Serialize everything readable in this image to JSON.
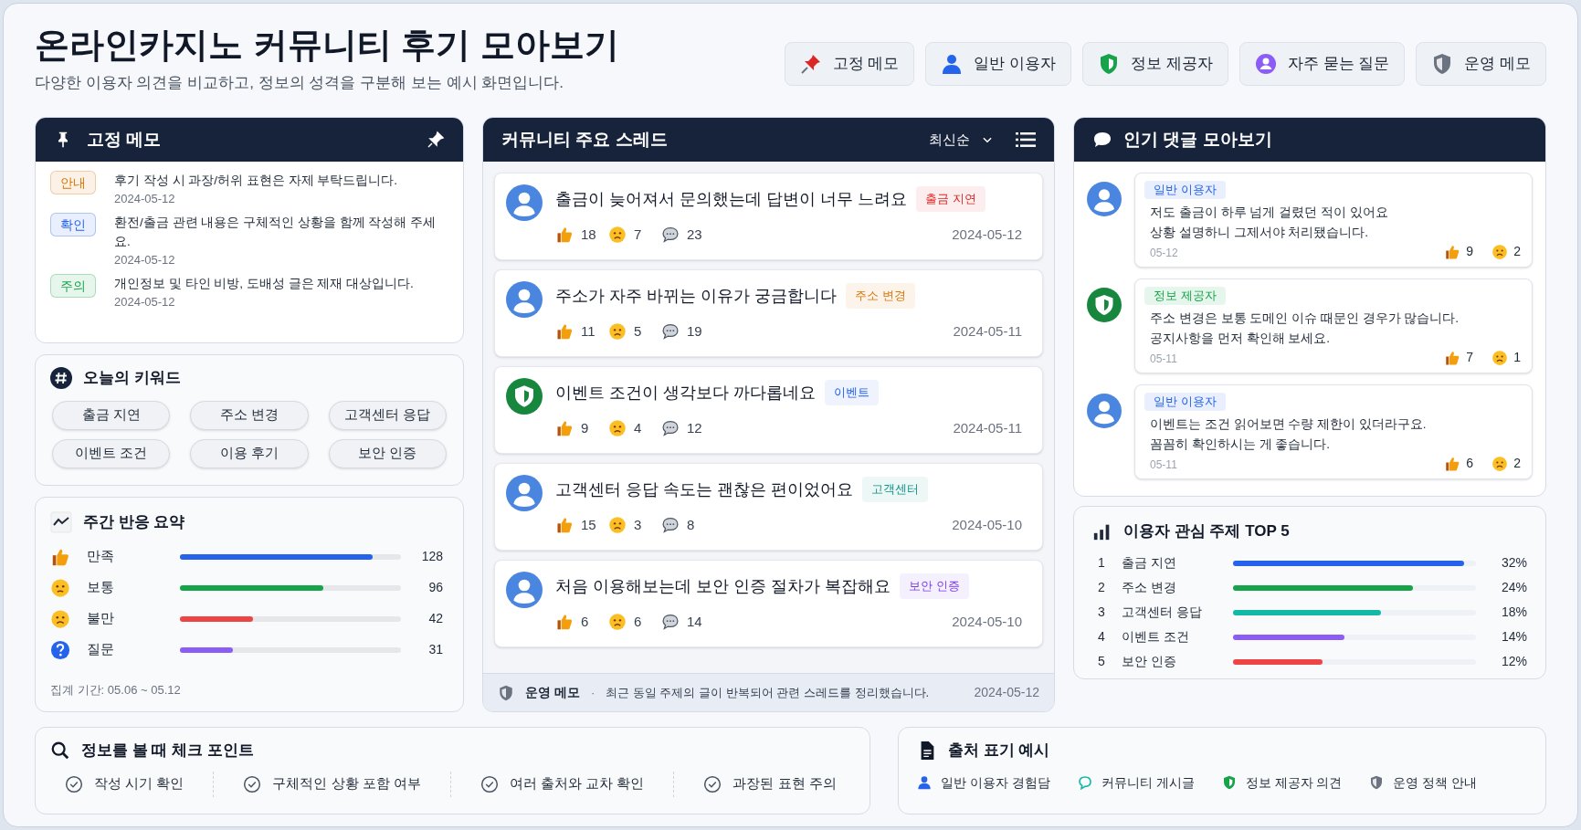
{
  "header": {
    "title": "온라인카지노 커뮤니티 후기 모아보기",
    "subtitle": "다양한 이용자 의견을 비교하고, 정보의 성격을 구분해 보는 예시 화면입니다."
  },
  "legend": [
    {
      "kind": "pin",
      "label": "고정 메모"
    },
    {
      "kind": "user",
      "label": "일반 이용자"
    },
    {
      "kind": "provider",
      "label": "정보 제공자"
    },
    {
      "kind": "faq",
      "label": "자주 묻는 질문"
    },
    {
      "kind": "admin",
      "label": "운영 메모"
    }
  ],
  "pinned": {
    "title": "고정 메모",
    "items": [
      {
        "badge": "안내",
        "color": "#d97706",
        "text": "후기 작성 시 과장/허위 표현은 자제 부탁드립니다.",
        "date": "2024-05-12"
      },
      {
        "badge": "확인",
        "color": "#2563eb",
        "text": "환전/출금 관련 내용은 구체적인 상황을 함께 작성해 주세요.",
        "date": "2024-05-12"
      },
      {
        "badge": "주의",
        "color": "#16a34a",
        "text": "개인정보 및 타인 비방, 도배성 글은 제재 대상입니다.",
        "date": "2024-05-12"
      }
    ]
  },
  "keywords": {
    "title": "오늘의 키워드",
    "items": [
      "출금 지연",
      "주소 변경",
      "고객센터 응답",
      "이벤트 조건",
      "이용 후기",
      "보안 인증"
    ]
  },
  "weekly": {
    "title": "주간 반응 요약",
    "rows": [
      {
        "kind": "like",
        "label": "만족",
        "level": 0.87,
        "value": "128",
        "color": "#2563eb"
      },
      {
        "kind": "neutral",
        "label": "보통",
        "level": 0.65,
        "value": "96",
        "color": "#16a34a"
      },
      {
        "kind": "sad",
        "label": "불만",
        "level": 0.33,
        "value": "42",
        "color": "#ef4444"
      },
      {
        "kind": "question",
        "label": "질문",
        "level": 0.24,
        "value": "31",
        "color": "#8b5cf6"
      }
    ],
    "footnote": "집계 기간: 05.06 ~ 05.12"
  },
  "threads": {
    "title": "커뮤니티 주요 스레드",
    "sort": "최신순",
    "items": [
      {
        "kind": "user",
        "title": "출금이 늦어져서 문의했는데 답변이 너무 느려요",
        "tag": "출금 지연",
        "color": "#dc2626",
        "likes": "18",
        "dislikes": "7",
        "comments": "23",
        "date": "2024-05-12"
      },
      {
        "kind": "user",
        "title": "주소가 자주 바뀌는 이유가 궁금합니다",
        "tag": "주소 변경",
        "color": "#d97706",
        "likes": "11",
        "dislikes": "5",
        "comments": "19",
        "date": "2024-05-11"
      },
      {
        "kind": "provider",
        "title": "이벤트 조건이 생각보다 까다롭네요",
        "tag": "이벤트",
        "color": "#2563eb",
        "likes": "9",
        "dislikes": "4",
        "comments": "12",
        "date": "2024-05-11"
      },
      {
        "kind": "user",
        "title": "고객센터 응답 속도는 괜찮은 편이었어요",
        "tag": "고객센터",
        "color": "#0d9488",
        "likes": "15",
        "dislikes": "3",
        "comments": "8",
        "date": "2024-05-10"
      },
      {
        "kind": "user",
        "title": "처음 이용해보는데 보안 인증 절차가 복잡해요",
        "tag": "보안 인증",
        "color": "#7c3aed",
        "likes": "6",
        "dislikes": "6",
        "comments": "14",
        "date": "2024-05-10"
      }
    ],
    "notice": {
      "label": "운영 메모",
      "separator": "·",
      "text": "최근 동일 주제의 글이 반복되어 관련 스레드를 정리했습니다.",
      "date": "2024-05-12"
    }
  },
  "comments": {
    "title": "인기 댓글 모아보기",
    "items": [
      {
        "kind": "user",
        "role": "일반 이용자",
        "text": "저도 출금이 하루 넘게 걸렸던 적이 있어요\n상황 설명하니 그제서야 처리됐습니다.",
        "date": "05-12",
        "likes": "9",
        "dislikes": "2"
      },
      {
        "kind": "provider",
        "role": "정보 제공자",
        "text": "주소 변경은 보통 도메인 이슈 때문인 경우가 많습니다.\n공지사항을 먼저 확인해 보세요.",
        "date": "05-11",
        "likes": "7",
        "dislikes": "1"
      },
      {
        "kind": "user",
        "role": "일반 이용자",
        "text": "이벤트는 조건 읽어보면 수량 제한이 있더라구요.\n꼼꼼히 확인하시는 게 좋습니다.",
        "date": "05-11",
        "likes": "6",
        "dislikes": "2"
      }
    ]
  },
  "top5": {
    "title": "이용자 관심 주제 TOP 5",
    "rows": [
      {
        "rank": "1",
        "label": "출금 지연",
        "level": 0.95,
        "value": "32%",
        "color": "#2563eb"
      },
      {
        "rank": "2",
        "label": "주소 변경",
        "level": 0.74,
        "value": "24%",
        "color": "#16a34a"
      },
      {
        "rank": "3",
        "label": "고객센터 응답",
        "level": 0.61,
        "value": "18%",
        "color": "#14b8a6"
      },
      {
        "rank": "4",
        "label": "이벤트 조건",
        "level": 0.46,
        "value": "14%",
        "color": "#8b5cf6"
      },
      {
        "rank": "5",
        "label": "보안 인증",
        "level": 0.37,
        "value": "12%",
        "color": "#ef4444"
      }
    ]
  },
  "checkpoints": {
    "title": "정보를 볼 때 체크 포인트",
    "items": [
      "작성 시기 확인",
      "구체적인 상황 포함 여부",
      "여러 출처와 교차 확인",
      "과장된 표현 주의"
    ]
  },
  "sources": {
    "title": "출처 표기 예시",
    "items": [
      {
        "kind": "user",
        "label": "일반 이용자 경험담"
      },
      {
        "kind": "community",
        "label": "커뮤니티 게시글"
      },
      {
        "kind": "provider",
        "label": "정보 제공자 의견"
      },
      {
        "kind": "admin",
        "label": "운영 정책 안내"
      }
    ]
  }
}
